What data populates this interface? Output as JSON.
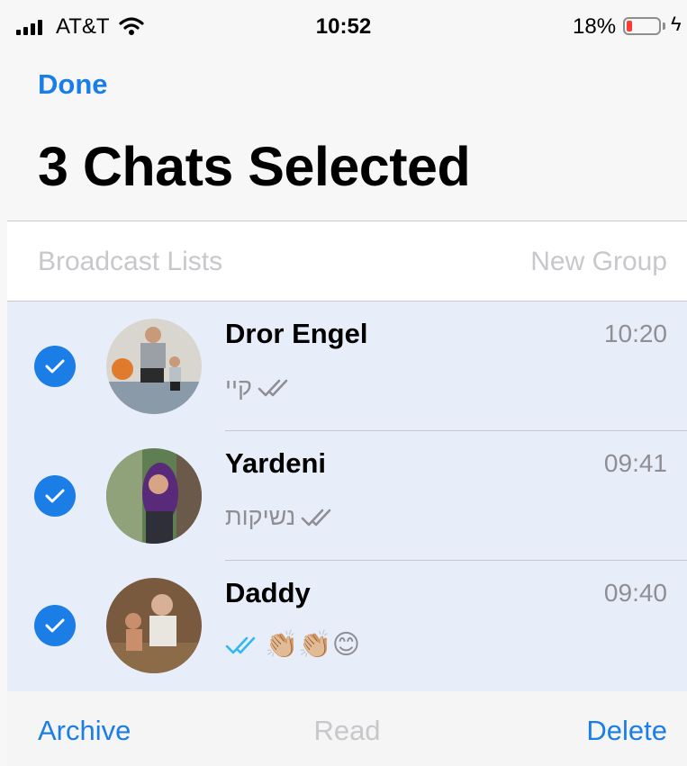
{
  "status_bar": {
    "carrier": "AT&T",
    "time": "10:52",
    "battery_percent": "18%",
    "battery_level": 0.18,
    "battery_color": "#ff3b30",
    "icons": [
      "signal-bars-icon",
      "wifi-icon",
      "battery-icon",
      "charging-bolt-icon"
    ]
  },
  "header": {
    "done_label": "Done",
    "title": "3 Chats Selected"
  },
  "actions_row": {
    "broadcast_label": "Broadcast Lists",
    "new_group_label": "New Group"
  },
  "chats": [
    {
      "name": "Dror Engel",
      "time": "10:20",
      "preview": "קיי",
      "selected": true,
      "read_status": "delivered",
      "avatar_desc": "photo"
    },
    {
      "name": "Yardeni",
      "time": "09:41",
      "preview": "נשיקות",
      "selected": true,
      "read_status": "delivered",
      "avatar_desc": "photo"
    },
    {
      "name": "Daddy",
      "time": "09:40",
      "preview": "👏🏼👏🏼😊",
      "selected": true,
      "read_status": "read",
      "avatar_desc": "photo"
    }
  ],
  "toolbar": {
    "archive_label": "Archive",
    "read_label": "Read",
    "delete_label": "Delete"
  },
  "colors": {
    "accent": "#1a7ee6",
    "selected_row_bg": "#e8eef9",
    "disabled_text": "#c7c7cc",
    "secondary_text": "#8e8e93",
    "read_ticks": "#34b7f1"
  }
}
